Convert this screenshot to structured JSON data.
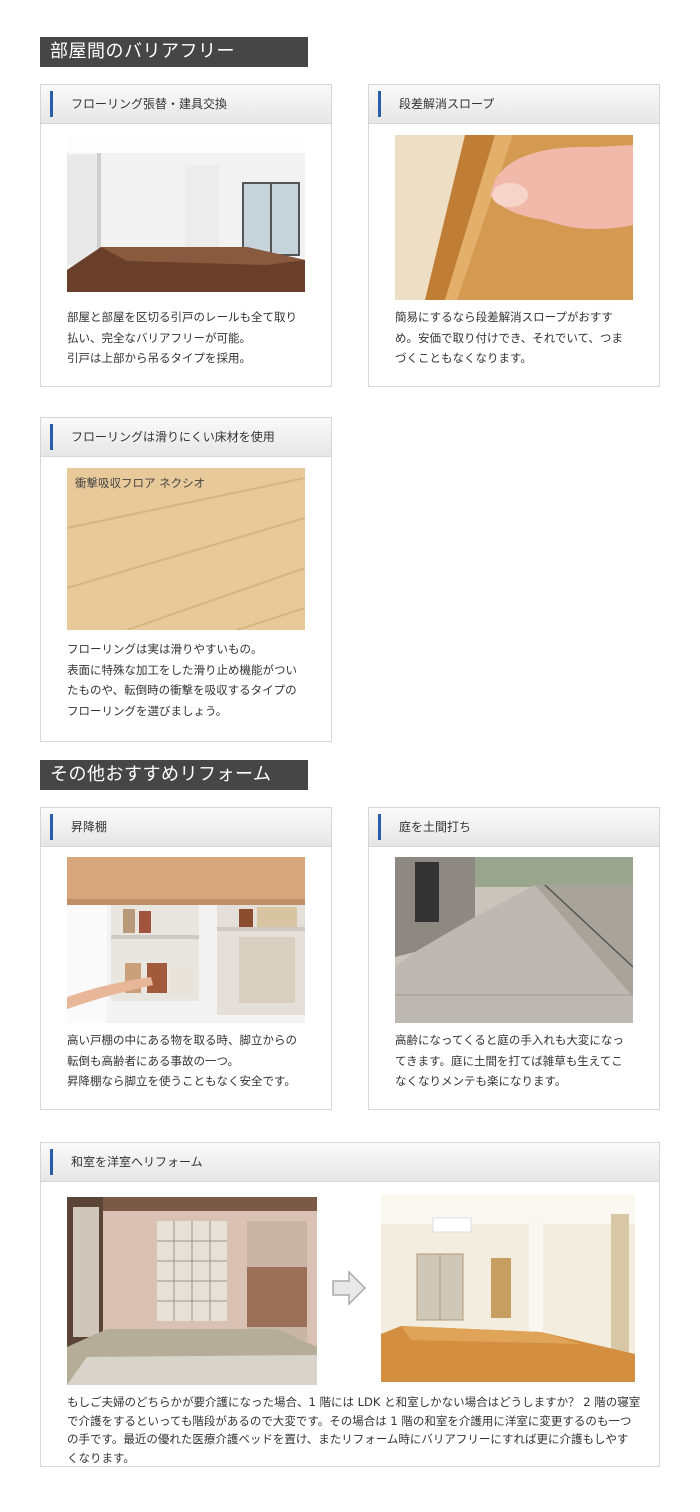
{
  "sections": {
    "barrier_free_title": "部屋間のバリアフリー",
    "other_title": "その他おすすめリフォーム"
  },
  "cards": {
    "flooring": {
      "title": "フローリング張替・建具交換",
      "lines": [
        "部屋と部屋を区切る引戸のレールも全て取り",
        "払い、完全なバリアフリーが可能。",
        "引戸は上部から吊るタイプを採用。"
      ]
    },
    "slope": {
      "title": "段差解消スロープ",
      "lines": [
        "簡易にするなら段差解消スロープがおすす",
        "め。安価で取り付けでき、それでいて、つま",
        "づくこともなくなります。"
      ]
    },
    "nonslip": {
      "title": "フローリングは滑りにくい床材を使用",
      "photo_caption": "衝撃吸収フロア ネクシオ",
      "lines": [
        "フローリングは実は滑りやすいもの。",
        "表面に特殊な加工をした滑り止め機能がつい",
        "たものや、転倒時の衝撃を吸収するタイプの",
        "フローリングを選びましょう。"
      ]
    },
    "shelf": {
      "title": "昇降棚",
      "lines": [
        "高い戸棚の中にある物を取る時、脚立からの",
        "転倒も高齢者にある事故の一つ。",
        "昇降棚なら脚立を使うこともなく安全です。"
      ]
    },
    "doma": {
      "title": "庭を土間打ち",
      "lines": [
        "高齢になってくると庭の手入れも大変になっ",
        "てきます。庭に土間を打てば雑草も生えてこ",
        "なくなりメンテも楽になります。"
      ]
    },
    "washitsu": {
      "title": "和室を洋室へリフォーム",
      "lines": [
        "もしご夫婦のどちらかが要介護になった場合、1 階には LDK と和室しかない場合はどうしますか？ 2 階の寝室",
        "で介護をするといっても階段があるので大変です。その場合は 1 階の和室を介護用に洋室に変更するのも一つ",
        "の手です。最近の優れた医療介護ベッドを置け、またリフォーム時にバリアフリーにすれば更に介護もしやす",
        "くなります。"
      ]
    }
  }
}
